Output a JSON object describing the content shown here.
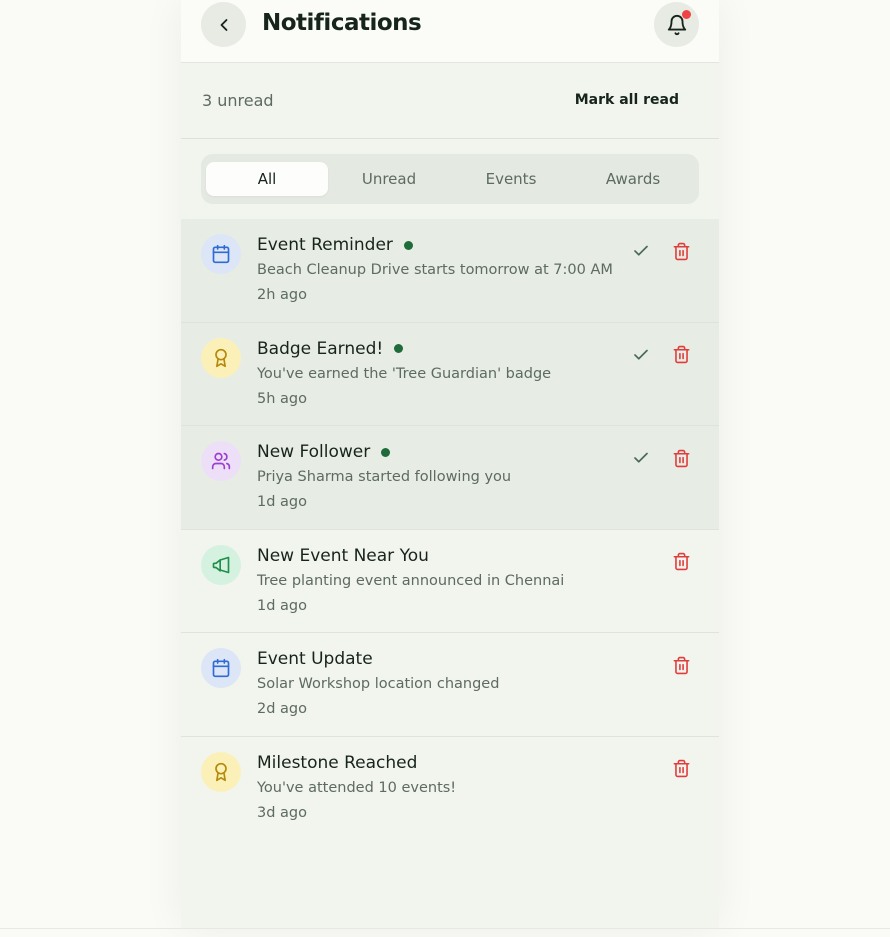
{
  "header": {
    "title": "Notifications",
    "back_icon": "chevron-left-icon",
    "bell_icon": "bell-icon"
  },
  "summary": {
    "unread_label": "3 unread",
    "mark_all_label": "Mark all read"
  },
  "tabs": [
    {
      "label": "All",
      "active": true
    },
    {
      "label": "Unread",
      "active": false
    },
    {
      "label": "Events",
      "active": false
    },
    {
      "label": "Awards",
      "active": false
    }
  ],
  "colors": {
    "accent_green": "#1f6b3a",
    "delete_red": "#e03c3c",
    "bell_dot": "#ef4444",
    "calendar_bg": "#dce6f7",
    "calendar_fg": "#2f6bd6",
    "award_bg": "#fbf1b8",
    "award_fg": "#b58a0a",
    "users_bg": "#eedff8",
    "users_fg": "#9b3fd1",
    "megaphone_bg": "#d4f2df",
    "megaphone_fg": "#1f8f4a"
  },
  "notifications": [
    {
      "title": "Event Reminder",
      "message": "Beach Cleanup Drive starts tomorrow at 7:00 AM",
      "time": "2h ago",
      "unread": true,
      "icon": "calendar-icon"
    },
    {
      "title": "Badge Earned!",
      "message": "You've earned the 'Tree Guardian' badge",
      "time": "5h ago",
      "unread": true,
      "icon": "award-icon"
    },
    {
      "title": "New Follower",
      "message": "Priya Sharma started following you",
      "time": "1d ago",
      "unread": true,
      "icon": "users-icon"
    },
    {
      "title": "New Event Near You",
      "message": "Tree planting event announced in Chennai",
      "time": "1d ago",
      "unread": false,
      "icon": "megaphone-icon"
    },
    {
      "title": "Event Update",
      "message": "Solar Workshop location changed",
      "time": "2d ago",
      "unread": false,
      "icon": "calendar-icon"
    },
    {
      "title": "Milestone Reached",
      "message": "You've attended 10 events!",
      "time": "3d ago",
      "unread": false,
      "icon": "award-icon"
    }
  ]
}
